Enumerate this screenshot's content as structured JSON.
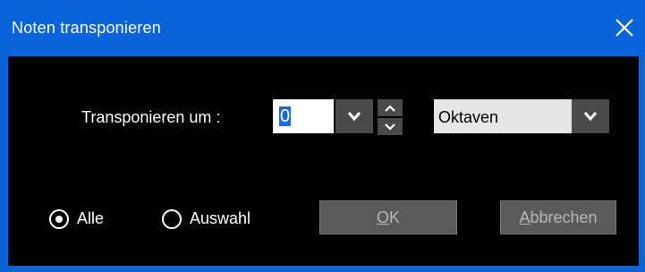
{
  "window": {
    "title": "Noten transponieren",
    "close_icon": "close-icon"
  },
  "form": {
    "transpose_label": "Transponieren um :",
    "amount_value": "0",
    "unit_value": "Oktaven"
  },
  "scope": {
    "options": [
      {
        "label": "Alle",
        "selected": true
      },
      {
        "label": "Auswahl",
        "selected": false
      }
    ]
  },
  "buttons": {
    "ok": {
      "accel": "O",
      "rest": "K",
      "enabled": false
    },
    "cancel": {
      "accel": "A",
      "rest": "bbrechen",
      "enabled": false
    }
  },
  "colors": {
    "titlebar": "#0b63d9",
    "client_bg": "#000000",
    "selection": "#1f6ad8",
    "control_dark": "#4a4a4a",
    "select_bg": "#e6e6e6",
    "button_disabled_bg": "#5a5a5a",
    "button_disabled_text": "#b8b8b8"
  }
}
